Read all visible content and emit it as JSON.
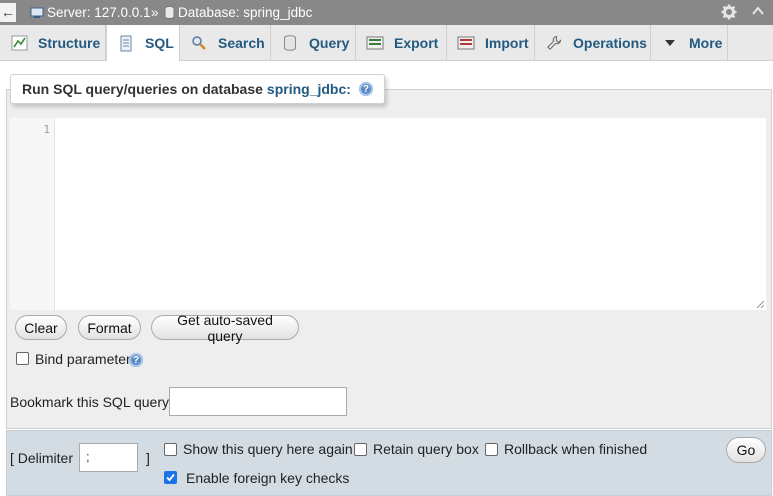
{
  "topbar": {
    "back_icon": "←",
    "server_label": "Server: 127.0.0.1",
    "separator": "»",
    "database_label": "Database: spring_jdbc",
    "settings_icon": "gear-icon",
    "collapse_icon": "chevron-up-icon"
  },
  "tabs": [
    {
      "label": "Structure",
      "icon": "structure-icon",
      "active": false
    },
    {
      "label": "SQL",
      "icon": "sql-icon",
      "active": true
    },
    {
      "label": "Search",
      "icon": "search-icon",
      "active": false
    },
    {
      "label": "Query",
      "icon": "query-icon",
      "active": false
    },
    {
      "label": "Export",
      "icon": "export-icon",
      "active": false
    },
    {
      "label": "Import",
      "icon": "import-icon",
      "active": false
    },
    {
      "label": "Operations",
      "icon": "wrench-icon",
      "active": false
    },
    {
      "label": "More",
      "icon": "caret-down-icon",
      "active": false
    }
  ],
  "sql_panel": {
    "legend_prefix": "Run SQL query/queries on database",
    "database_name": "spring_jdbc:",
    "help_glyph": "?",
    "editor": {
      "line_number": "1",
      "value": ""
    },
    "buttons": {
      "clear": "Clear",
      "format": "Format",
      "auto_saved": "Get auto-saved query"
    },
    "bind_parameters": {
      "label": "Bind parameters",
      "checked": false
    },
    "bookmark": {
      "label": "Bookmark this SQL query:",
      "value": ""
    }
  },
  "footer": {
    "delimiter_open": "[ Delimiter",
    "delimiter_value": ";",
    "delimiter_close": "]",
    "show_query_again": {
      "label": "Show this query here again",
      "checked": false
    },
    "retain_query_box": {
      "label": "Retain query box",
      "checked": false
    },
    "rollback": {
      "label": "Rollback when finished",
      "checked": false
    },
    "foreign_key_checks": {
      "label": "Enable foreign key checks",
      "checked": true
    },
    "go_button": "Go"
  },
  "colors": {
    "topbar": "#888888",
    "tab_text": "#235a81",
    "footer_bg": "#d3dce3",
    "checkbox_checked": "#1a73e8"
  }
}
